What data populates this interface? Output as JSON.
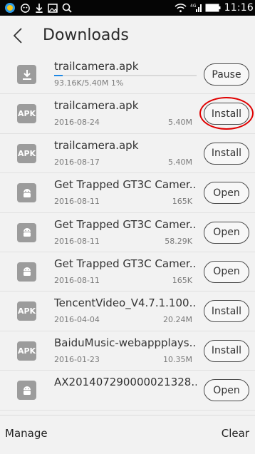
{
  "status_bar": {
    "time": "11:16",
    "network": "4G",
    "icons_left": [
      "app-icon",
      "chat-icon",
      "download-icon",
      "image-icon",
      "search-icon"
    ],
    "icons_right": [
      "wifi-icon",
      "signal-icon",
      "battery-icon"
    ]
  },
  "header": {
    "title": "Downloads"
  },
  "downloads": [
    {
      "icon": "download",
      "name": "trailcamera.apk",
      "progress_text": "93.16K/5.40M  1%",
      "progress_fraction": 0.01,
      "action": "Pause"
    },
    {
      "icon": "apk",
      "name": "trailcamera.apk",
      "date": "2016-08-24",
      "size": "5.40M",
      "action": "Install",
      "highlighted": true
    },
    {
      "icon": "apk",
      "name": "trailcamera.apk",
      "date": "2016-08-17",
      "size": "5.40M",
      "action": "Install"
    },
    {
      "icon": "android",
      "name": "Get Trapped GT3C Camer...",
      "date": "2016-08-11",
      "size": "165K",
      "action": "Open"
    },
    {
      "icon": "android",
      "name": "Get Trapped GT3C Camer...",
      "date": "2016-08-11",
      "size": "58.29K",
      "action": "Open"
    },
    {
      "icon": "android",
      "name": "Get Trapped GT3C Camer...",
      "date": "2016-08-11",
      "size": "165K",
      "action": "Open"
    },
    {
      "icon": "apk",
      "name": "TencentVideo_V4.7.1.100...",
      "date": "2016-04-04",
      "size": "20.24M",
      "action": "Install"
    },
    {
      "icon": "apk",
      "name": "BaiduMusic-webappplays...",
      "date": "2016-01-23",
      "size": "10.35M",
      "action": "Install"
    },
    {
      "icon": "android",
      "name": "AX201407290000021328....",
      "date": "",
      "size": "",
      "action": "Open"
    }
  ],
  "apk_badge": "APK",
  "bottom_bar": {
    "manage_label": "Manage",
    "clear_label": "Clear"
  },
  "colors": {
    "accent": "#1e88e5",
    "highlight": "#e00000",
    "icon_gray": "#9c9c9c"
  }
}
